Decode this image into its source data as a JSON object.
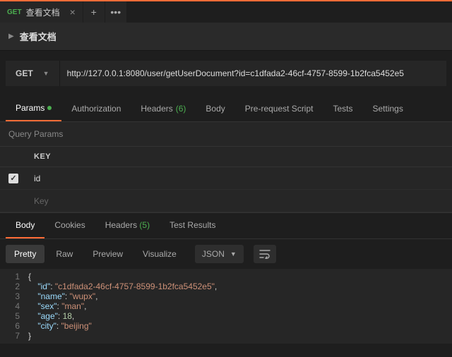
{
  "tab": {
    "method": "GET",
    "title": "查看文档"
  },
  "breadcrumb": {
    "title": "查看文档"
  },
  "request": {
    "method": "GET",
    "url": "http://127.0.0.1:8080/user/getUserDocument?id=c1dfada2-46cf-4757-8599-1b2fca5452e5"
  },
  "reqTabs": {
    "params": "Params",
    "authorization": "Authorization",
    "headers": "Headers",
    "headers_count": "(6)",
    "body": "Body",
    "prerequest": "Pre-request Script",
    "tests": "Tests",
    "settings": "Settings"
  },
  "query": {
    "section": "Query Params",
    "keyHeader": "KEY",
    "row1_checked": true,
    "row1_key": "id",
    "placeholder": "Key"
  },
  "respTabs": {
    "body": "Body",
    "cookies": "Cookies",
    "headers": "Headers",
    "headers_count": "(5)",
    "tests": "Test Results"
  },
  "bodyToolbar": {
    "pretty": "Pretty",
    "raw": "Raw",
    "preview": "Preview",
    "visualize": "Visualize",
    "format": "JSON"
  },
  "response": {
    "id_k": "\"id\"",
    "id_v": "\"c1dfada2-46cf-4757-8599-1b2fca5452e5\"",
    "name_k": "\"name\"",
    "name_v": "\"wupx\"",
    "sex_k": "\"sex\"",
    "sex_v": "\"man\"",
    "age_k": "\"age\"",
    "age_v": "18",
    "city_k": "\"city\"",
    "city_v": "\"beijing\""
  },
  "glyph": {
    "brace_open": "{",
    "brace_close": "}",
    "colon": ": ",
    "comma": ","
  }
}
